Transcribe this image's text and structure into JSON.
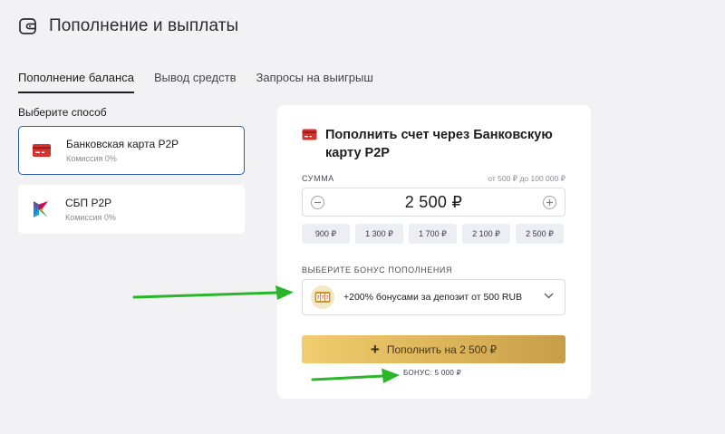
{
  "header": {
    "title": "Пополнение и выплаты",
    "icon": "wallet-icon"
  },
  "tabs": [
    {
      "label": "Пополнение баланса",
      "active": true
    },
    {
      "label": "Вывод средств",
      "active": false
    },
    {
      "label": "Запросы на выигрыш",
      "active": false
    }
  ],
  "methods": {
    "heading": "Выберите способ",
    "items": [
      {
        "name": "Банковская карта P2P",
        "fee": "Комиссия 0%",
        "icon": "bank-card-icon",
        "selected": true
      },
      {
        "name": "СБП P2P",
        "fee": "Комиссия 0%",
        "icon": "sbp-icon",
        "selected": false
      }
    ]
  },
  "panel": {
    "title": "Пополнить счет через Банковскую карту P2P",
    "sum_label": "СУММА",
    "range": "от 500 ₽ до 100 000 ₽",
    "amount": "2 500 ₽",
    "presets": [
      "900 ₽",
      "1 300 ₽",
      "1 700 ₽",
      "2 100 ₽",
      "2 500 ₽"
    ],
    "bonus_label": "ВЫБЕРИТЕ БОНУС ПОПОЛНЕНИЯ",
    "bonus_option": "+200% бонусами за депозит от 500 RUB",
    "deposit_button": "Пополнить на 2 500 ₽",
    "bonus_note": "БОНУС: 5 000 ₽"
  },
  "colors": {
    "accent_border": "#2f5da8",
    "card_red": "#d8322c",
    "button_gold": "#dcb45a",
    "arrow_green": "#2bb52b"
  }
}
